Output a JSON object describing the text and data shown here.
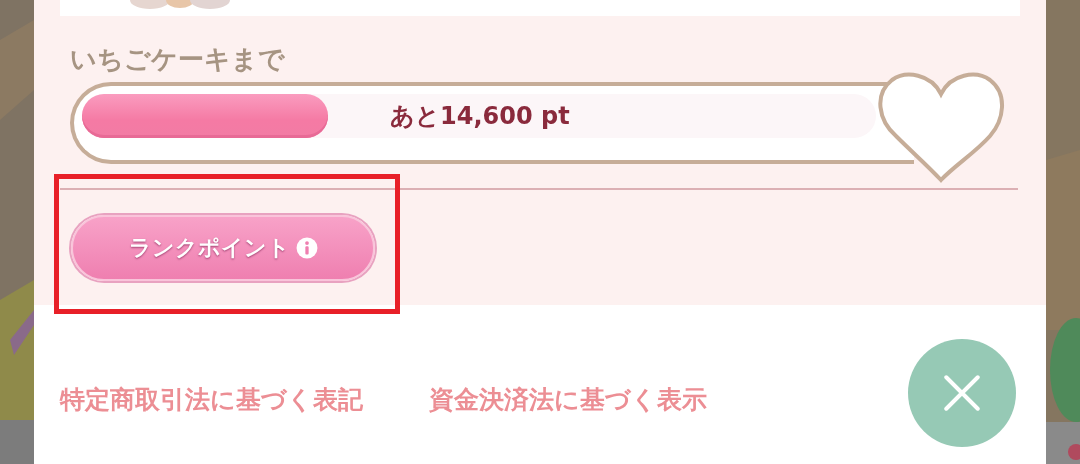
{
  "goal": {
    "label": "いちごケーキまで",
    "level": 0.31,
    "remaining": "あと14,600 pt"
  },
  "rank_button": {
    "label": "ランクポイント",
    "highlighted": true
  },
  "footer_links": [
    {
      "label": "特定商取引法に基づく表記"
    },
    {
      "label": "資金決済法に基づく表示"
    }
  ]
}
